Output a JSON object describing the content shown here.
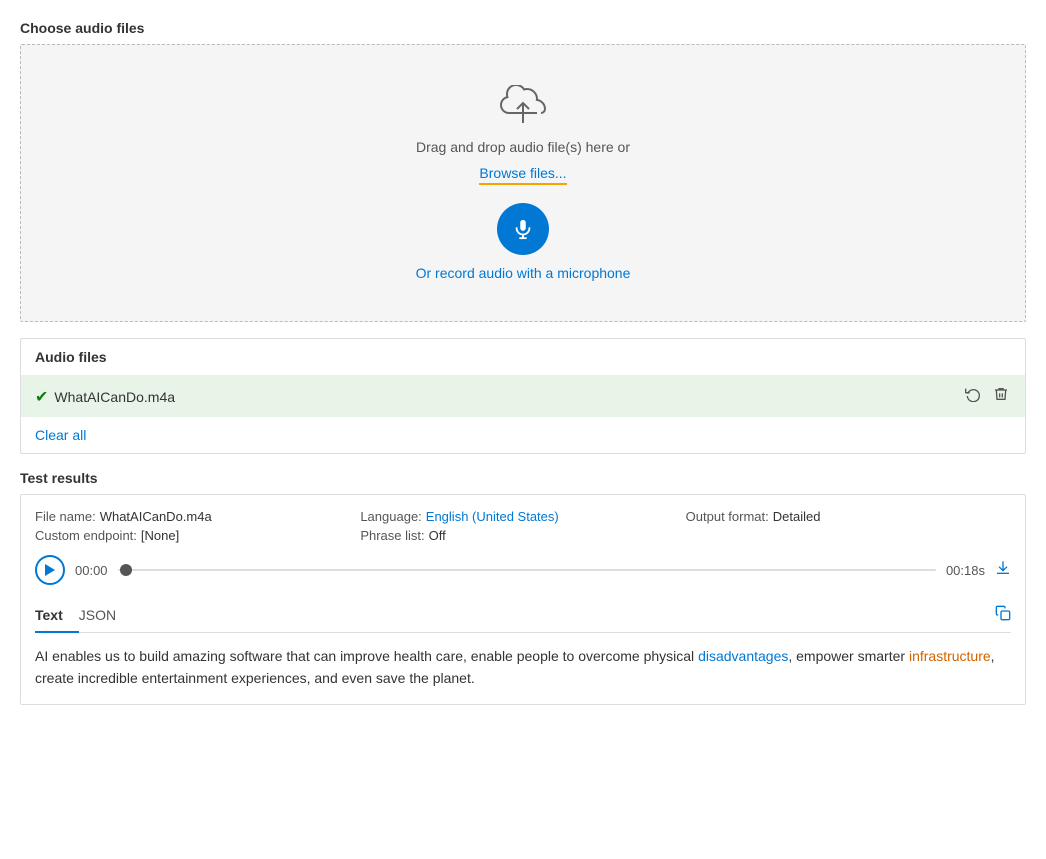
{
  "choose_audio": {
    "label": "Choose audio files",
    "drop_text": "Drag and drop audio file(s) here or",
    "browse_label": "Browse files...",
    "record_label": "Or record audio with a microphone"
  },
  "audio_files": {
    "panel_title": "Audio files",
    "file_name": "WhatAICanDo.m4a",
    "clear_all_label": "Clear all"
  },
  "test_results": {
    "label": "Test results",
    "file_name_key": "File name:",
    "file_name_val": "WhatAICanDo.m4a",
    "language_key": "Language:",
    "language_val": "English (United States)",
    "output_format_key": "Output format:",
    "output_format_val": "Detailed",
    "custom_endpoint_key": "Custom endpoint:",
    "custom_endpoint_val": "[None]",
    "phrase_list_key": "Phrase list:",
    "phrase_list_val": "Off",
    "time_start": "00:00",
    "time_end": "00:18s",
    "tab_text": "Text",
    "tab_json": "JSON",
    "transcript": "AI enables us to build amazing software that can improve health care, enable people to overcome physical disadvantages, empower smarter infrastructure, create incredible entertainment experiences, and even save the planet."
  }
}
